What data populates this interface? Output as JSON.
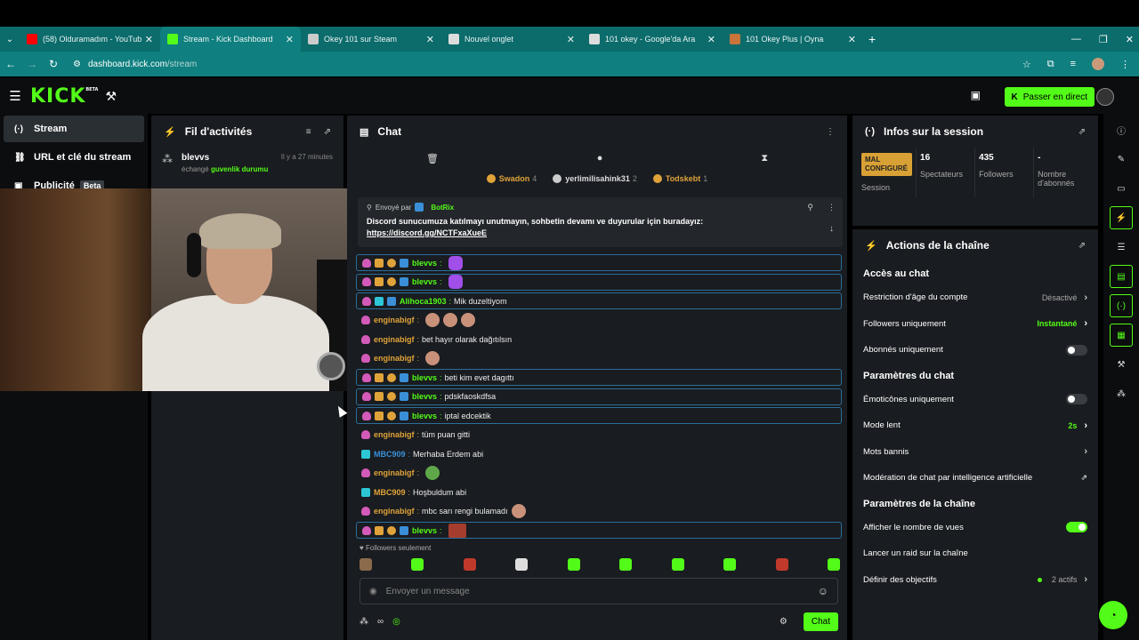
{
  "browser": {
    "tabs": [
      {
        "label": "(58) Olduramadım - YouTube",
        "icon": "youtube-icon",
        "color": "#ff0000",
        "active": false
      },
      {
        "label": "Stream - Kick Dashboard",
        "icon": "kick-icon",
        "color": "#53fc18",
        "active": true
      },
      {
        "label": "Okey 101 sur Steam",
        "icon": "steam-icon",
        "color": "#cccccc",
        "active": false
      },
      {
        "label": "Nouvel onglet",
        "icon": "chrome-icon",
        "color": "#dddddd",
        "active": false
      },
      {
        "label": "101 okey - Google'da Ara",
        "icon": "google-icon",
        "color": "#dddddd",
        "active": false
      },
      {
        "label": "101 Okey Plus | Oyna",
        "icon": "game-icon",
        "color": "#c9743a",
        "active": false
      }
    ],
    "url_host": "dashboard.kick.com",
    "url_path": "/stream"
  },
  "header": {
    "logo": "KICK",
    "logo_tag": "BETA",
    "go_live": "Passer en direct"
  },
  "leftnav": [
    {
      "label": "Stream",
      "icon": "broadcast-icon",
      "active": true
    },
    {
      "label": "URL et clé du stream",
      "icon": "link-icon",
      "active": false
    },
    {
      "label": "Publicité",
      "icon": "ad-icon",
      "badge": "Beta",
      "active": false
    }
  ],
  "activity": {
    "title": "Fil d'activités",
    "items": [
      {
        "user": "blevvs",
        "time": "Il y a 27 minutes",
        "action": "échangé",
        "reward": "guvenlik durumu"
      }
    ]
  },
  "chat": {
    "title": "Chat",
    "top_gifters": [
      {
        "name": "Swadon",
        "count": "4"
      },
      {
        "name": "yerlimilisahink31",
        "count": "2"
      },
      {
        "name": "Todskebt",
        "count": "1"
      }
    ],
    "pinned": {
      "by_label": "Envoyé par",
      "by_user": "BotRix",
      "text": "Discord sunucumuza katılmayı unutmayın, sohbetin devamı ve duyurular için buradayız:",
      "link": "https://discord.gg/NCTFxaXueE"
    },
    "messages": [
      {
        "user": "blevvs",
        "color": "#53fc18",
        "text": "",
        "highlight": true,
        "badges": [
          "pink",
          "crown",
          "coin",
          "blue"
        ],
        "emotes": [
          "purple"
        ]
      },
      {
        "user": "blevvs",
        "color": "#53fc18",
        "text": "",
        "highlight": true,
        "badges": [
          "pink",
          "crown",
          "coin",
          "blue"
        ],
        "emotes": [
          "purple"
        ]
      },
      {
        "user": "Alihoca1903",
        "color": "#53fc18",
        "text": "Mik duzeltiyom",
        "highlight": true,
        "badges": [
          "pink",
          "teal",
          "blue"
        ],
        "emotes": []
      },
      {
        "user": "enginabigf",
        "color": "#e0a33a",
        "text": "",
        "highlight": false,
        "badges": [
          "pink"
        ],
        "emotes": [
          "face",
          "face",
          "face"
        ]
      },
      {
        "user": "enginabigf",
        "color": "#e0a33a",
        "text": "bet hayır olarak dağıtılsın",
        "highlight": false,
        "badges": [
          "pink"
        ],
        "emotes": []
      },
      {
        "user": "enginabigf",
        "color": "#e0a33a",
        "text": "",
        "highlight": false,
        "badges": [
          "pink"
        ],
        "emotes": [
          "face"
        ]
      },
      {
        "user": "blevvs",
        "color": "#53fc18",
        "text": "beti kim evet dagıttı",
        "highlight": true,
        "badges": [
          "pink",
          "crown",
          "coin",
          "blue"
        ],
        "emotes": []
      },
      {
        "user": "blevvs",
        "color": "#53fc18",
        "text": "pdskfaoskdfsa",
        "highlight": true,
        "badges": [
          "pink",
          "crown",
          "coin",
          "blue"
        ],
        "emotes": []
      },
      {
        "user": "blevvs",
        "color": "#53fc18",
        "text": "iptal edcektik",
        "highlight": true,
        "badges": [
          "pink",
          "crown",
          "coin",
          "blue"
        ],
        "emotes": []
      },
      {
        "user": "enginabigf",
        "color": "#e0a33a",
        "text": "tüm puan gitti",
        "highlight": false,
        "badges": [
          "pink"
        ],
        "emotes": []
      },
      {
        "user": "MBC909",
        "color": "#3a8fd8",
        "text": "Merhaba Erdem abi",
        "highlight": false,
        "badges": [
          "teal"
        ],
        "emotes": []
      },
      {
        "user": "enginabigf",
        "color": "#e0a33a",
        "text": "",
        "highlight": false,
        "badges": [
          "pink"
        ],
        "emotes": [
          "pepe"
        ]
      },
      {
        "user": "MBC909",
        "color": "#e0a33a",
        "text": "Hoşbuldum abi",
        "highlight": false,
        "badges": [
          "teal"
        ],
        "emotes": []
      },
      {
        "user": "enginabigf",
        "color": "#e0a33a",
        "text": "mbc sarı rengi bulamadı",
        "highlight": false,
        "badges": [
          "pink"
        ],
        "emotes": [
          "face"
        ]
      },
      {
        "user": "blevvs",
        "color": "#53fc18",
        "text": "",
        "highlight": true,
        "badges": [
          "pink",
          "crown",
          "coin",
          "blue"
        ],
        "emotes": [
          "red"
        ]
      }
    ],
    "followers_only": "Followers seulement",
    "input_placeholder": "Envoyer un message",
    "send_label": "Chat",
    "infinity": "∞"
  },
  "session": {
    "title": "Infos sur la session",
    "stats": [
      {
        "value": "MAL CONFIGURÉ",
        "label": "Session",
        "warn": true
      },
      {
        "value": "16",
        "label": "Spectateurs"
      },
      {
        "value": "435",
        "label": "Followers"
      },
      {
        "value": "-",
        "label": "Nombre d'abonnés"
      }
    ]
  },
  "actions": {
    "title": "Actions de la chaîne",
    "sections": [
      {
        "title": "Accès au chat",
        "rows": [
          {
            "label": "Restriction d'âge du compte",
            "value": "Désactivé",
            "type": "chevron"
          },
          {
            "label": "Followers uniquement",
            "value": "Instantané",
            "type": "chevron",
            "green": true
          },
          {
            "label": "Abonnés uniquement",
            "type": "toggle",
            "on": false
          }
        ]
      },
      {
        "title": "Paramètres du chat",
        "rows": [
          {
            "label": "Émoticônes uniquement",
            "type": "toggle",
            "on": false
          },
          {
            "label": "Mode lent",
            "value": "2s",
            "type": "chevron",
            "green": true
          },
          {
            "label": "Mots bannis",
            "type": "chevron"
          },
          {
            "label": "Modération de chat par intelligence artificielle",
            "type": "external"
          }
        ]
      },
      {
        "title": "Paramètres de la chaîne",
        "rows": [
          {
            "label": "Afficher le nombre de vues",
            "type": "toggle",
            "on": true
          },
          {
            "label": "Lancer un raid sur la chaîne",
            "type": "none"
          },
          {
            "label": "Définir des objectifs",
            "value": "2 actifs",
            "type": "chevron",
            "dot": true
          }
        ]
      }
    ]
  }
}
